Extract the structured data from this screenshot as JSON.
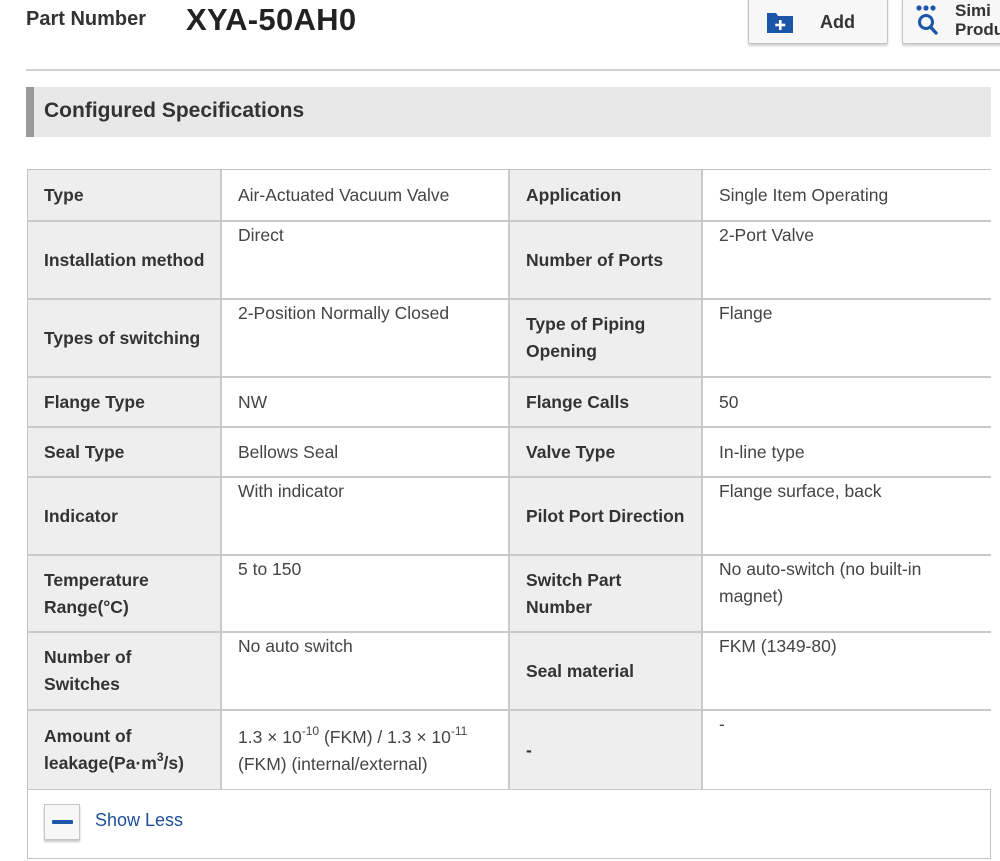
{
  "header": {
    "part_number_label": "Part Number",
    "part_number_value": "XYA-50AH0",
    "add_button_label": "Add",
    "similar_button_label_line1": "Simi",
    "similar_button_label_line2": "Produ",
    "add_icon": "folder-plus-icon",
    "similar_icon": "search-similar-icon",
    "accent_color": "#1b56a8"
  },
  "section": {
    "title": "Configured Specifications"
  },
  "specs": [
    {
      "l1": "Type",
      "v1": "Air-Actuated Vacuum Valve",
      "l2": "Application",
      "v2": "Single Item Operating"
    },
    {
      "l1": "Installation method",
      "v1": "Direct",
      "l2": "Number of Ports",
      "v2": "2-Port Valve"
    },
    {
      "l1": "Types of switching",
      "v1": "2-Position Normally Closed",
      "l2": "Type of Piping Opening",
      "v2": "Flange"
    },
    {
      "l1": "Flange Type",
      "v1": "NW",
      "l2": "Flange Calls",
      "v2": "50"
    },
    {
      "l1": "Seal Type",
      "v1": "Bellows Seal",
      "l2": "Valve Type",
      "v2": "In-line type"
    },
    {
      "l1": "Indicator",
      "v1": "With indicator",
      "l2": "Pilot Port Direction",
      "v2": "Flange surface, back"
    },
    {
      "l1": "Temperature Range(°C)",
      "v1": "5 to 150",
      "l2": "Switch Part Number",
      "v2": "No auto-switch (no built-in magnet)"
    },
    {
      "l1": "Number of Switches",
      "v1": "No auto switch",
      "l2": "Seal material",
      "v2": "FKM (1349-80)"
    }
  ],
  "leakage": {
    "label_prefix": "Amount of leakage(Pa·m",
    "label_sup": "3",
    "label_suffix": "/s)",
    "value_a": "1.3 × 10",
    "value_a_exp": "-10",
    "value_b": " (FKM) / 1.3 × 10",
    "value_b_exp": "-11",
    "value_c": " (FKM) (internal/external)",
    "label2": "-",
    "value2": "-"
  },
  "footer": {
    "show_less_label": "Show Less",
    "toggle_icon": "minus-icon"
  }
}
